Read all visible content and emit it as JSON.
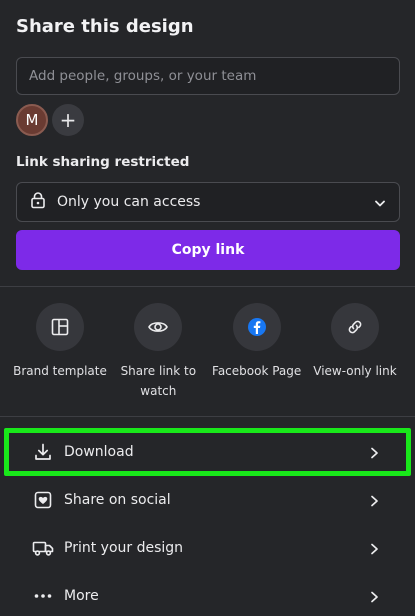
{
  "title": "Share this design",
  "search": {
    "placeholder": "Add people, groups, or your team",
    "value": ""
  },
  "avatar_initial": "M",
  "add_symbol": "+",
  "link_sharing": {
    "label": "Link sharing restricted",
    "selected": "Only you can access"
  },
  "copy_button": "Copy link",
  "colors": {
    "accent": "#7d2ae8",
    "highlight": "#19e81a",
    "facebook": "#1877f2"
  },
  "actions": [
    {
      "label": "Brand template",
      "icon": "brand-template-icon"
    },
    {
      "label": "Share link to watch",
      "icon": "eye-icon"
    },
    {
      "label": "Facebook Page",
      "icon": "facebook-icon"
    },
    {
      "label": "View-only link",
      "icon": "link-icon"
    }
  ],
  "menu": [
    {
      "label": "Download",
      "icon": "download-icon"
    },
    {
      "label": "Share on social",
      "icon": "heart-icon"
    },
    {
      "label": "Print your design",
      "icon": "truck-icon"
    },
    {
      "label": "More",
      "icon": "more-icon"
    }
  ]
}
